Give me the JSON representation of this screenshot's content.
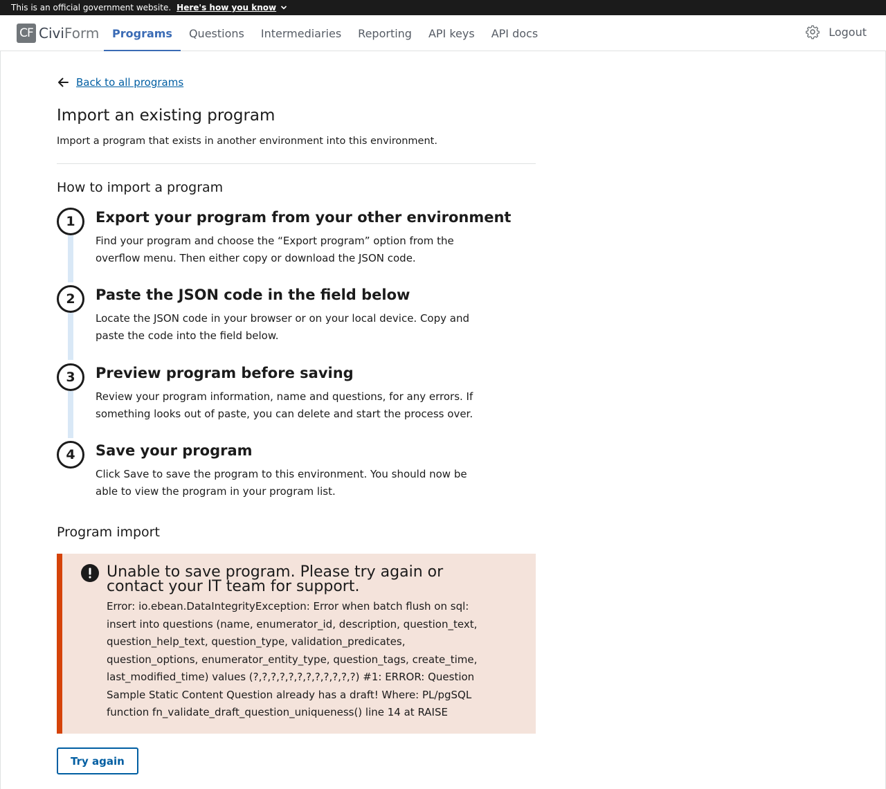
{
  "gov_banner": {
    "official_text": "This is an official government website.",
    "how_link": "Here's how you know"
  },
  "header": {
    "logo_badge": "CF",
    "logo_civi": "Civi",
    "logo_form": "Form",
    "nav": [
      {
        "label": "Programs",
        "active": true
      },
      {
        "label": "Questions"
      },
      {
        "label": "Intermediaries"
      },
      {
        "label": "Reporting"
      },
      {
        "label": "API keys"
      },
      {
        "label": "API docs"
      }
    ],
    "logout": "Logout"
  },
  "main": {
    "back_link": "Back to all programs",
    "title": "Import an existing program",
    "description": "Import a program that exists in another environment into this environment.",
    "how_heading": "How to import a program",
    "steps": [
      {
        "num": "1",
        "title": "Export your program from your other environment",
        "text": "Find your program and choose the “Export program” option from the overflow menu. Then either copy or download the JSON code."
      },
      {
        "num": "2",
        "title": "Paste the JSON code in the field below",
        "text": "Locate the JSON code in your browser or on your local device. Copy and paste the code into the field below."
      },
      {
        "num": "3",
        "title": "Preview program before saving",
        "text": "Review your program information, name and questions, for any errors. If something looks out of paste, you can delete and start the process over."
      },
      {
        "num": "4",
        "title": "Save your program",
        "text": "Click Save to save the program to this environment. You should now be able to view the program in your program list."
      }
    ],
    "import_heading": "Program import",
    "alert": {
      "heading": "Unable to save program. Please try again or contact your IT team for support.",
      "text": "Error: io.ebean.DataIntegrityException: Error when batch flush on sql: insert into questions (name, enumerator_id, description, question_text, question_help_text, question_type, validation_predicates, question_options, enumerator_entity_type, question_tags, create_time, last_modified_time) values (?,?,?,?,?,?,?,?,?,?,?,?) #1: ERROR: Question Sample Static Content Question already has a draft! Where: PL/pgSQL function fn_validate_draft_question_uniqueness() line 14 at RAISE"
    },
    "try_again": "Try again"
  },
  "colors": {
    "link": "#005ea2",
    "active_nav": "#3a6bb5",
    "alert_bg": "#f4e3db",
    "alert_border": "#d54309",
    "step_line": "#d9e8f6"
  }
}
